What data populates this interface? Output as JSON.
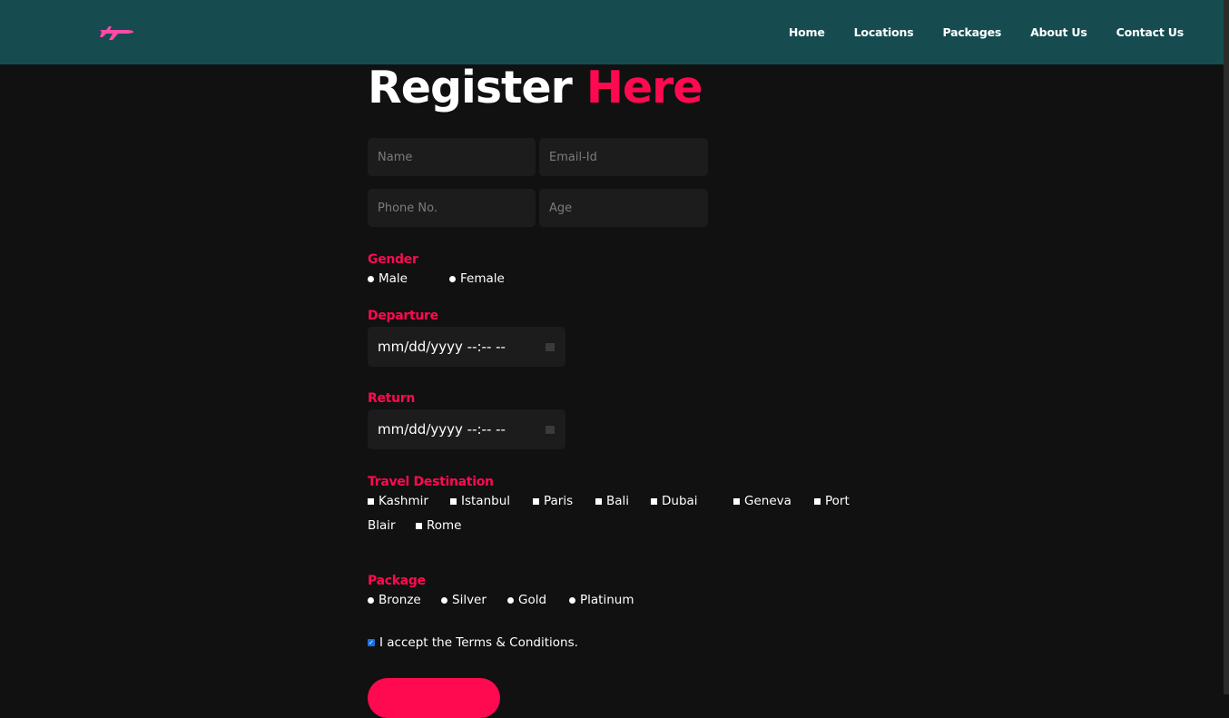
{
  "nav": {
    "logo_icon": "airplane-icon",
    "links": [
      "Home",
      "Locations",
      "Packages",
      "About Us",
      "Contact Us"
    ]
  },
  "form": {
    "title_main": "Register",
    "title_accent": "Here",
    "name_placeholder": "Name",
    "email_placeholder": "Email-Id",
    "phone_placeholder": "Phone No.",
    "age_placeholder": "Age",
    "gender_label": "Gender",
    "genders": [
      "Male",
      "Female"
    ],
    "departure_label": "Departure",
    "departure_value": "mm/dd/yyyy --:-- --",
    "return_label": "Return",
    "return_value": "mm/dd/yyyy --:-- --",
    "destination_label": "Travel Destination",
    "destinations": [
      "Kashmir",
      "Istanbul",
      "Paris",
      "Bali",
      "Dubai",
      "Geneva",
      "Port",
      "Blair",
      "Rome"
    ],
    "package_label": "Package",
    "packages": [
      "Bronze",
      "Silver",
      "Gold",
      "Platinum"
    ],
    "terms_label": "I accept the Terms & Conditions.",
    "terms_checked": true
  },
  "colors": {
    "navbar": "#164c50",
    "accent": "#ff0a50",
    "background": "#111111"
  }
}
